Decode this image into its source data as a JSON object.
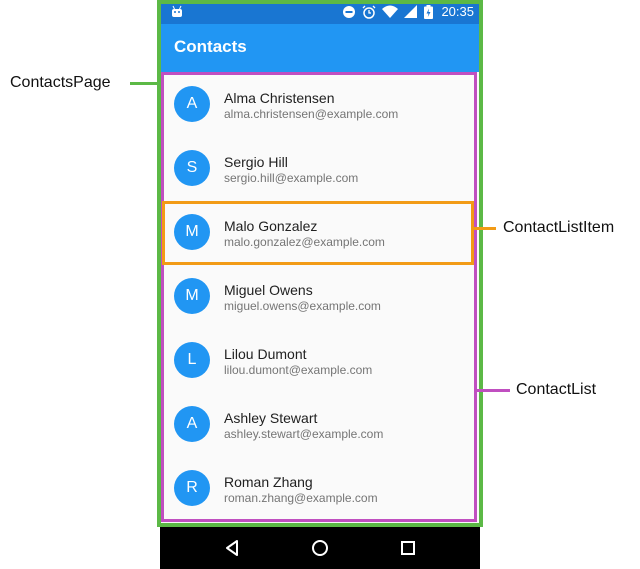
{
  "colors": {
    "status_bar": "#1976d2",
    "app_bar": "#2196f3",
    "avatar": "#2196f3",
    "page_outline": "#5cb946",
    "list_outline": "#c04fc0",
    "item_outline": "#f29b16"
  },
  "status_bar": {
    "time": "20:35",
    "icons": [
      "android-icon",
      "do-not-disturb-icon",
      "alarm-icon",
      "wifi-icon",
      "signal-icon",
      "battery-icon"
    ]
  },
  "app_bar": {
    "title": "Contacts"
  },
  "contacts": [
    {
      "initial": "A",
      "name": "Alma Christensen",
      "email": "alma.christensen@example.com"
    },
    {
      "initial": "S",
      "name": "Sergio Hill",
      "email": "sergio.hill@example.com"
    },
    {
      "initial": "M",
      "name": "Malo Gonzalez",
      "email": "malo.gonzalez@example.com"
    },
    {
      "initial": "M",
      "name": "Miguel Owens",
      "email": "miguel.owens@example.com"
    },
    {
      "initial": "L",
      "name": "Lilou Dumont",
      "email": "lilou.dumont@example.com"
    },
    {
      "initial": "A",
      "name": "Ashley Stewart",
      "email": "ashley.stewart@example.com"
    },
    {
      "initial": "R",
      "name": "Roman Zhang",
      "email": "roman.zhang@example.com"
    }
  ],
  "annotations": {
    "page_label": "ContactsPage",
    "item_label": "ContactListItem",
    "list_label": "ContactList"
  },
  "nav_bar": {
    "icons": [
      "back-icon",
      "home-icon",
      "recents-icon"
    ]
  }
}
